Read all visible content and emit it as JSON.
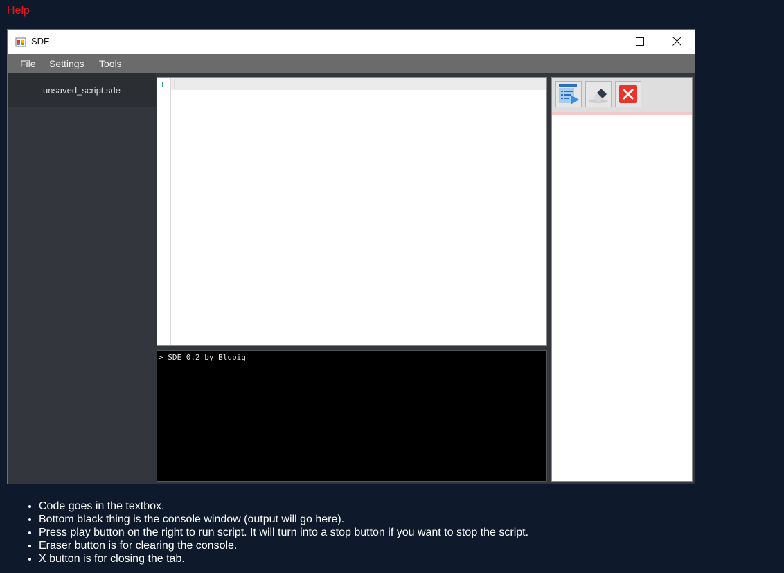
{
  "help_link": "Help",
  "window": {
    "title": "SDE",
    "menu": [
      "File",
      "Settings",
      "Tools"
    ]
  },
  "tabs": [
    {
      "label": "unsaved_script.sde"
    }
  ],
  "editor": {
    "line_numbers": [
      "1"
    ]
  },
  "console": {
    "lines": [
      "> SDE 0.2 by Blupig"
    ]
  },
  "toolbar": {
    "buttons": [
      "run-script-icon",
      "eraser-icon",
      "close-tab-icon"
    ]
  },
  "notes": [
    "Code goes in the textbox.",
    "Bottom black thing is the console window (output will go here).",
    "Press play button on the right to run script. It will turn into a stop button if you want to stop the script.",
    "Eraser button is for clearing the console.",
    "X button is for closing the tab."
  ],
  "colors": {
    "page_bg": "#0e1a2b",
    "help_link": "#e8161f",
    "window_border": "#1f84d6",
    "sidebar_bg": "#33373d",
    "menubar_bg": "#6b6b6b",
    "close_tab_red": "#e8352b",
    "run_blue": "#3a8ee6"
  }
}
